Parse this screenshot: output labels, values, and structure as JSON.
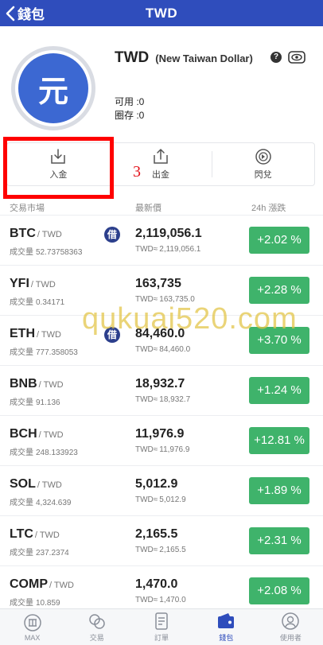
{
  "header": {
    "back_label": "錢包",
    "title": "TWD"
  },
  "currency": {
    "symbol_glyph": "元",
    "code": "TWD",
    "full_name": "(New Taiwan Dollar)",
    "help_glyph": "?",
    "available_label": "可用 :",
    "available_value": "0",
    "reserved_label": "圈存 :",
    "reserved_value": "0"
  },
  "actions": [
    {
      "label": "入金",
      "icon": "deposit-icon"
    },
    {
      "label": "出金",
      "icon": "withdraw-icon"
    },
    {
      "label": "閃兌",
      "icon": "flash-swap-icon"
    }
  ],
  "annotation": {
    "step_number": "3",
    "color": "#ff0000"
  },
  "list_header": {
    "market": "交易市場",
    "last_price": "最新價",
    "change_24h": "24h 漲跌"
  },
  "quote_currency": "/ TWD",
  "volume_label": "成交量",
  "twd_prefix": "TWD≈",
  "borrow_badge": "借",
  "markets": [
    {
      "symbol": "BTC",
      "volume": "52.73758363",
      "price": "2,119,056.1",
      "twd": "2,119,056.1",
      "change": "+2.02 %",
      "badge": true
    },
    {
      "symbol": "YFI",
      "volume": "0.34171",
      "price": "163,735",
      "twd": "163,735.0",
      "change": "+2.28 %",
      "badge": false
    },
    {
      "symbol": "ETH",
      "volume": "777.358053",
      "price": "84,460.0",
      "twd": "84,460.0",
      "change": "+3.70 %",
      "badge": true
    },
    {
      "symbol": "BNB",
      "volume": "91.136",
      "price": "18,932.7",
      "twd": "18,932.7",
      "change": "+1.24 %",
      "badge": false
    },
    {
      "symbol": "BCH",
      "volume": "248.133923",
      "price": "11,976.9",
      "twd": "11,976.9",
      "change": "+12.81 %",
      "badge": false
    },
    {
      "symbol": "SOL",
      "volume": "4,324.639",
      "price": "5,012.9",
      "twd": "5,012.9",
      "change": "+1.89 %",
      "badge": false
    },
    {
      "symbol": "LTC",
      "volume": "237.2374",
      "price": "2,165.5",
      "twd": "2,165.5",
      "change": "+2.31 %",
      "badge": false
    },
    {
      "symbol": "COMP",
      "volume": "10.859",
      "price": "1,470.0",
      "twd": "1,470.0",
      "change": "+2.08 %",
      "badge": false
    }
  ],
  "watermark": "qukuai520.com",
  "bottom_nav": [
    {
      "label": "MAX",
      "icon": "max-icon",
      "active": false
    },
    {
      "label": "交易",
      "icon": "exchange-icon",
      "active": false
    },
    {
      "label": "訂單",
      "icon": "orders-icon",
      "active": false
    },
    {
      "label": "錢包",
      "icon": "wallet-icon",
      "active": true
    },
    {
      "label": "使用者",
      "icon": "user-icon",
      "active": false
    }
  ],
  "colors": {
    "header_bg": "#2f4dbc",
    "coin_bg": "#3c68d2",
    "positive_change": "#3fb36b",
    "badge_bg": "#2c3f8c",
    "watermark": "#e2c444"
  }
}
